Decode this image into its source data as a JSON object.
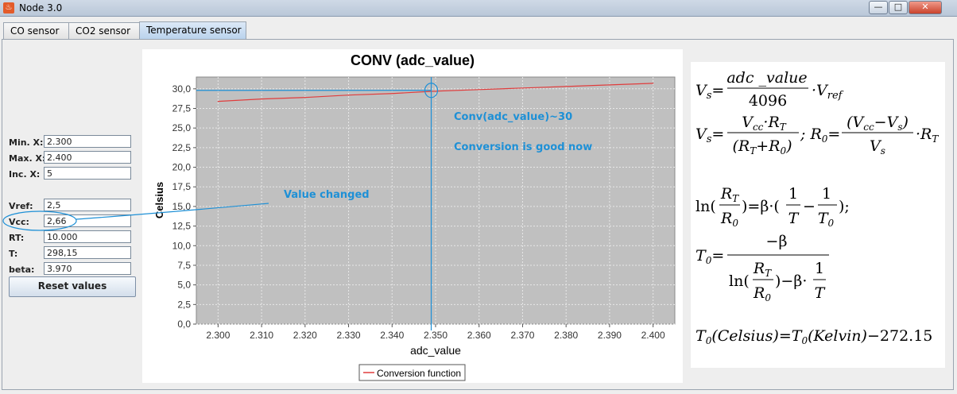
{
  "window": {
    "title": "Node 3.0",
    "controls": [
      "—",
      "□",
      "✕"
    ]
  },
  "tabs": [
    {
      "label": "CO sensor",
      "active": false
    },
    {
      "label": "CO2 sensor",
      "active": false
    },
    {
      "label": "Temperature sensor",
      "active": true
    }
  ],
  "fields": {
    "min_x": {
      "label": "Min. X:",
      "value": "2.300"
    },
    "max_x": {
      "label": "Max. X:",
      "value": "2.400"
    },
    "inc_x": {
      "label": "Inc. X:",
      "value": "5"
    },
    "vref": {
      "label": "Vref:",
      "value": "2,5"
    },
    "vcc": {
      "label": "Vcc:",
      "value": "2,66"
    },
    "rt": {
      "label": "RT:",
      "value": "10.000"
    },
    "t": {
      "label": "T:",
      "value": "298,15"
    },
    "beta": {
      "label": "beta:",
      "value": "3.970"
    }
  },
  "reset_button": "Reset values",
  "annotations": {
    "value_changed": "Value changed",
    "conv_note": "Conv(adc_value)~30",
    "conversion_good": "Conversion is good now"
  },
  "chart_data": {
    "type": "line",
    "title": "CONV (adc_value)",
    "xlabel": "adc_value",
    "ylabel": "Celsius",
    "xlim": [
      2.295,
      2.405
    ],
    "ylim": [
      0,
      31.5
    ],
    "x_ticks": [
      "2.300",
      "2.310",
      "2.320",
      "2.330",
      "2.340",
      "2.350",
      "2.360",
      "2.370",
      "2.380",
      "2.390",
      "2.400"
    ],
    "y_ticks": [
      "0,0",
      "2,5",
      "5,0",
      "7,5",
      "10,0",
      "12,5",
      "15,0",
      "17,5",
      "20,0",
      "22,5",
      "25,0",
      "27,5",
      "30,0"
    ],
    "series": [
      {
        "name": "Conversion function",
        "color": "#e03c3c",
        "x": [
          2.3,
          2.31,
          2.32,
          2.33,
          2.34,
          2.35,
          2.36,
          2.37,
          2.38,
          2.39,
          2.4
        ],
        "y": [
          28.4,
          28.7,
          28.9,
          29.2,
          29.4,
          29.7,
          29.9,
          30.1,
          30.3,
          30.5,
          30.7
        ]
      }
    ],
    "crosshair": {
      "x": 2.349,
      "y": 29.8
    },
    "grid": true,
    "plot_background": "#c0c0c0",
    "legend_position": "bottom"
  },
  "formulas": {
    "f1": "Vs = (adc_value / 4096) · Vref",
    "f2": "Vs = (Vcc · RT) / (RT + R0) ; R0 = ((Vcc − Vs) / Vs) · RT",
    "f3": "ln(RT / R0) = β · (1/T − 1/T0);",
    "f4": "T0 = −β / (ln(RT / R0) − β · 1/T)",
    "f5": "T0(Celsius) = T0(Kelvin) − 272.15"
  },
  "colors": {
    "annotation": "#1e90d6",
    "series": "#e03c3c",
    "plot_bg": "#c0c0c0"
  }
}
